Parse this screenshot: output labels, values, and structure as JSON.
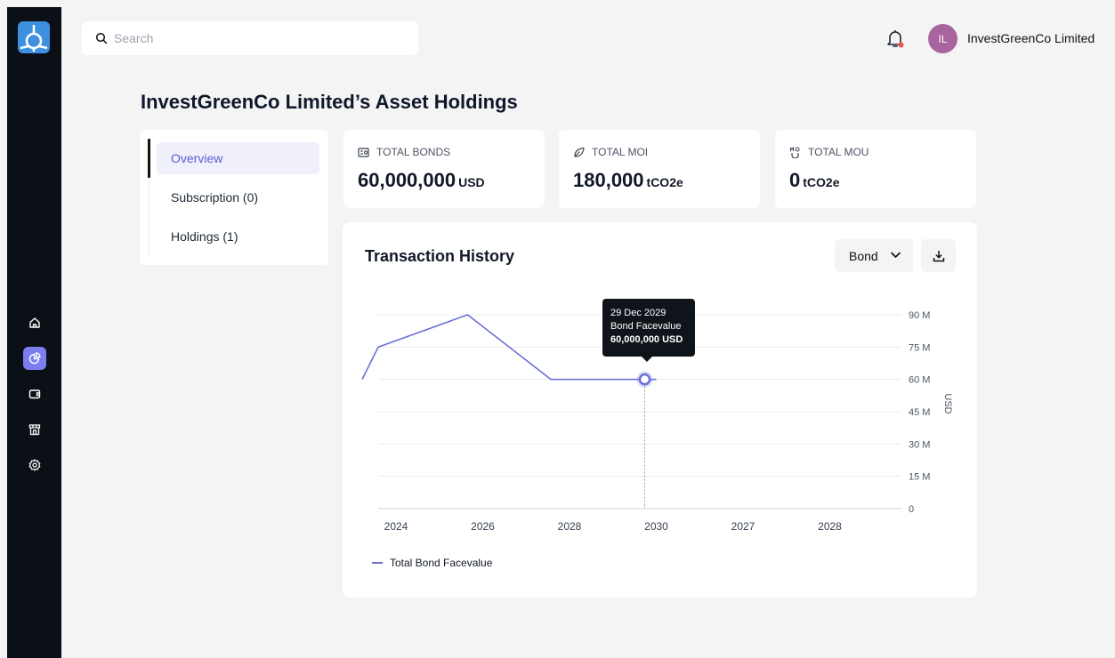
{
  "search": {
    "placeholder": "Search"
  },
  "user": {
    "initials": "IL",
    "name": "InvestGreenCo Limited"
  },
  "page": {
    "title": "InvestGreenCo Limited’s Asset Holdings"
  },
  "tabs": [
    {
      "label": "Overview",
      "active": true
    },
    {
      "label": "Subscription (0)"
    },
    {
      "label": "Holdings (1)"
    }
  ],
  "stats": [
    {
      "label": "TOTAL BONDS",
      "value": "60,000,000",
      "unit": "USD",
      "icon": "bond-icon"
    },
    {
      "label": "TOTAL MOI",
      "value": "180,000",
      "unit": "tCO2e",
      "icon": "leaf-icon"
    },
    {
      "label": "TOTAL MOU",
      "value": "0",
      "unit": "tCO2e",
      "icon": "mou-icon"
    }
  ],
  "sidebar": {
    "icons": [
      "home-icon",
      "pie-chart-icon",
      "wallet-icon",
      "store-icon",
      "gear-icon"
    ],
    "active": "pie-chart-icon"
  },
  "colors": {
    "accent": "#7b7ef0",
    "line": "#6b70d9",
    "logo": "#3d8fe0",
    "avatar": "#a8649c",
    "sidebar": "#0b1016"
  },
  "transaction": {
    "title": "Transaction History",
    "filter": "Bond",
    "tooltip": {
      "date": "29 Dec 2029",
      "label": "Bond Facevalue",
      "value": "60,000,000 USD"
    }
  },
  "chart_data": {
    "type": "line",
    "categories": [
      "2024",
      "2026",
      "2028",
      "2030",
      "2027",
      "2028"
    ],
    "series": [
      {
        "name": "Total Bond Facevalue",
        "values": [
          75000000,
          90000000,
          60000000,
          60000000
        ]
      }
    ],
    "leading_value": 60000000,
    "ylabel": "USD",
    "ylim": [
      0,
      90000000
    ],
    "yticks": [
      {
        "value": 0,
        "label": "0"
      },
      {
        "value": 15000000,
        "label": "15 M"
      },
      {
        "value": 30000000,
        "label": "30 M"
      },
      {
        "value": 45000000,
        "label": "45 M"
      },
      {
        "value": 60000000,
        "label": "60 M"
      },
      {
        "value": 75000000,
        "label": "75 M"
      },
      {
        "value": 90000000,
        "label": "90 M"
      }
    ],
    "highlight": {
      "index": 3,
      "value": 60000000
    },
    "grid": true,
    "legend_position": "bottom-left"
  }
}
